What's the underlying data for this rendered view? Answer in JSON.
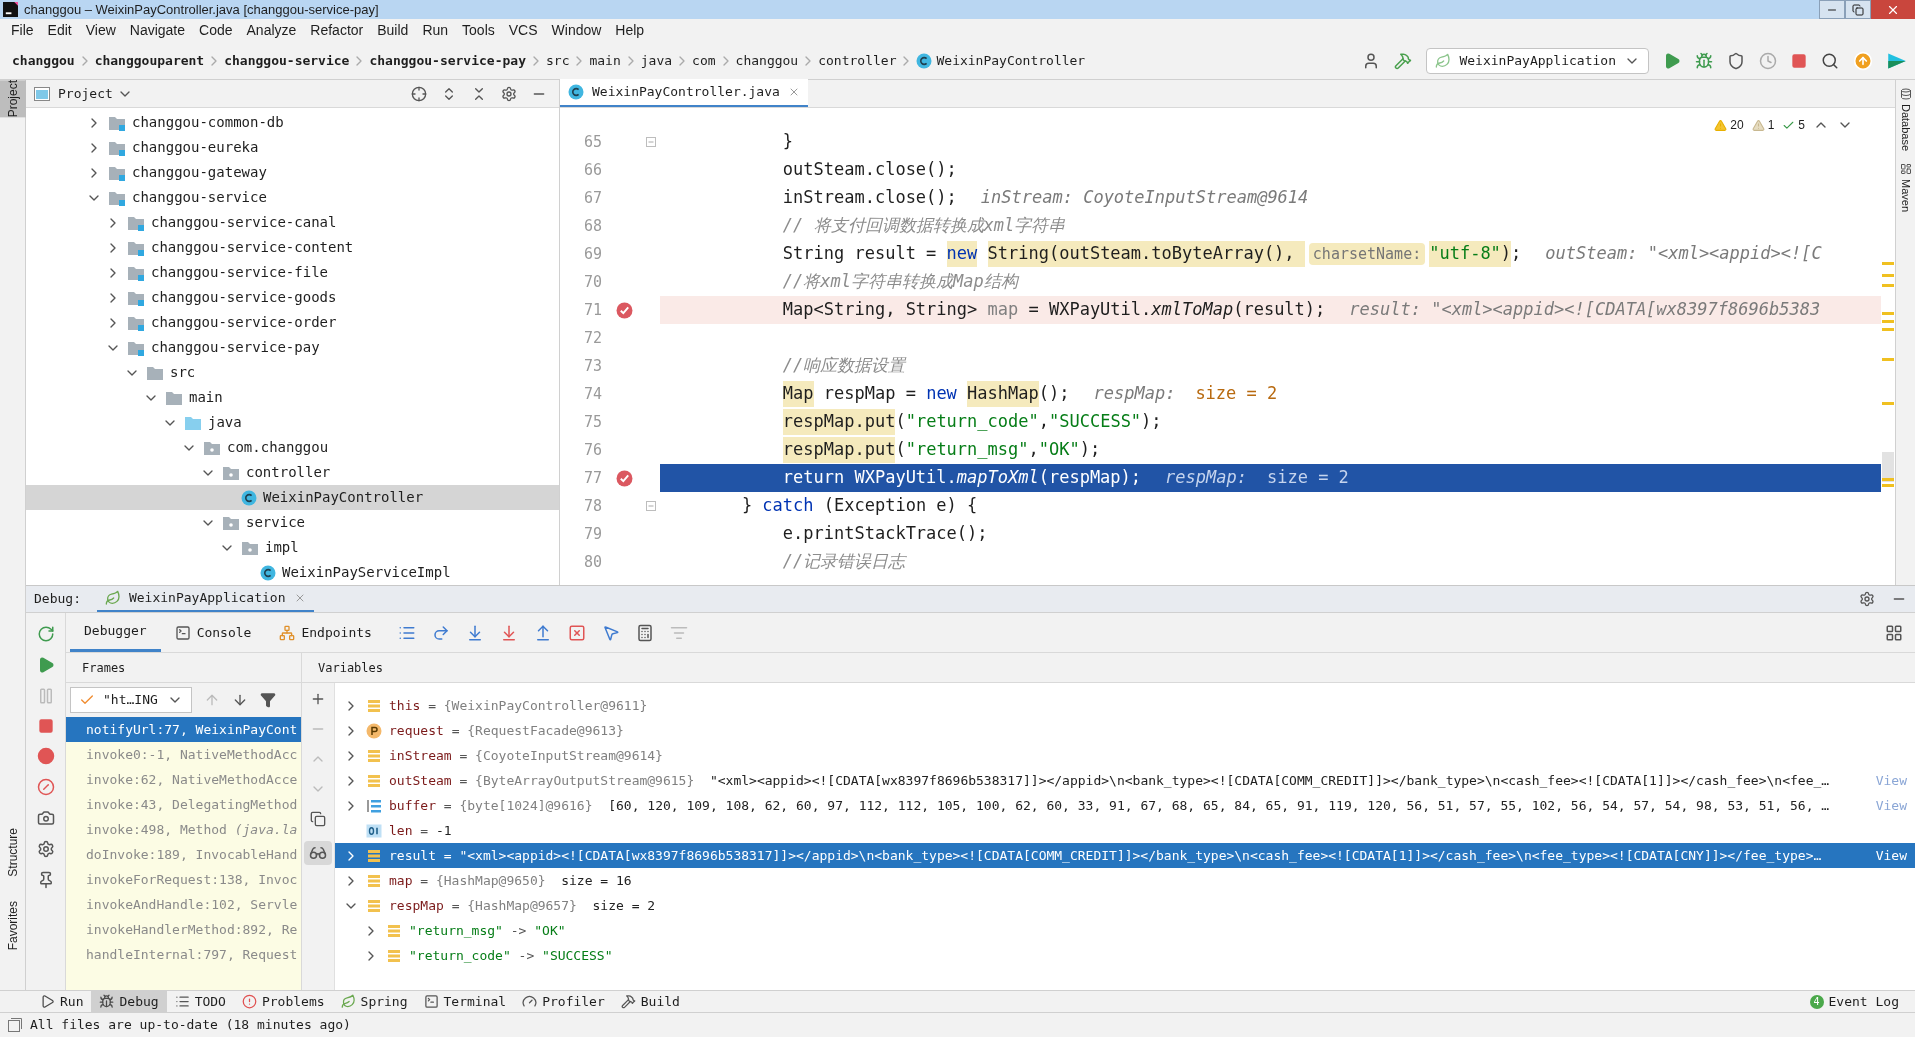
{
  "window": {
    "title": "changgou – WeixinPayController.java [changgou-service-pay]"
  },
  "menu": [
    {
      "label": "File"
    },
    {
      "label": "Edit"
    },
    {
      "label": "View"
    },
    {
      "label": "Navigate"
    },
    {
      "label": "Code"
    },
    {
      "label": "Analyze"
    },
    {
      "label": "Refactor"
    },
    {
      "label": "Build"
    },
    {
      "label": "Run"
    },
    {
      "label": "Tools"
    },
    {
      "label": "VCS"
    },
    {
      "label": "Window"
    },
    {
      "label": "Help"
    }
  ],
  "breadcrumb": [
    {
      "label": "changgou",
      "kind": "module"
    },
    {
      "label": "changgouparent",
      "kind": "module"
    },
    {
      "label": "changgou-service",
      "kind": "module"
    },
    {
      "label": "changgou-service-pay",
      "kind": "module"
    },
    {
      "label": "src",
      "kind": "folder"
    },
    {
      "label": "main",
      "kind": "folder"
    },
    {
      "label": "java",
      "kind": "folder"
    },
    {
      "label": "com",
      "kind": "folder"
    },
    {
      "label": "changgou",
      "kind": "folder"
    },
    {
      "label": "controller",
      "kind": "folder"
    },
    {
      "label": "WeixinPayController",
      "kind": "class"
    }
  ],
  "run_configuration": "WeixinPayApplication",
  "side_tabs_left": [
    {
      "label": "Project",
      "selected": true
    },
    {
      "label": "Structure",
      "selected": false
    },
    {
      "label": "Favorites",
      "selected": false
    }
  ],
  "side_tabs_right": [
    {
      "label": "Database"
    },
    {
      "label": "Maven"
    }
  ],
  "project_panel": {
    "title": "Project",
    "tree": [
      {
        "label": "changgou-common-db",
        "kind": "module",
        "expanded": false,
        "selected": false
      },
      {
        "label": "changgou-eureka",
        "kind": "module",
        "expanded": false,
        "selected": false
      },
      {
        "label": "changgou-gateway",
        "kind": "module",
        "expanded": false,
        "selected": false
      },
      {
        "label": "changgou-service",
        "kind": "module",
        "expanded": true,
        "selected": false,
        "children": [
          {
            "label": "changgou-service-canal",
            "kind": "module",
            "expanded": false,
            "selected": false
          },
          {
            "label": "changgou-service-content",
            "kind": "module",
            "expanded": false,
            "selected": false
          },
          {
            "label": "changgou-service-file",
            "kind": "module",
            "expanded": false,
            "selected": false
          },
          {
            "label": "changgou-service-goods",
            "kind": "module",
            "expanded": false,
            "selected": false
          },
          {
            "label": "changgou-service-order",
            "kind": "module",
            "expanded": false,
            "selected": false
          },
          {
            "label": "changgou-service-pay",
            "kind": "module",
            "expanded": true,
            "selected": false,
            "children": [
              {
                "label": "src",
                "kind": "folder",
                "expanded": true,
                "selected": false,
                "children": [
                  {
                    "label": "main",
                    "kind": "folder",
                    "expanded": true,
                    "selected": false,
                    "children": [
                      {
                        "label": "java",
                        "kind": "source-root",
                        "expanded": true,
                        "selected": false,
                        "children": [
                          {
                            "label": "com.changgou",
                            "kind": "package",
                            "expanded": true,
                            "selected": false,
                            "children": [
                              {
                                "label": "controller",
                                "kind": "package",
                                "expanded": true,
                                "selected": false,
                                "children": [
                                  {
                                    "label": "WeixinPayController",
                                    "kind": "class",
                                    "selected": true
                                  }
                                ]
                              },
                              {
                                "label": "service",
                                "kind": "package",
                                "expanded": true,
                                "selected": false,
                                "children": [
                                  {
                                    "label": "impl",
                                    "kind": "package",
                                    "expanded": true,
                                    "selected": false,
                                    "children": [
                                      {
                                        "label": "WeixinPayServiceImpl",
                                        "kind": "class",
                                        "selected": false
                                      }
                                    ]
                                  }
                                ]
                              }
                            ]
                          }
                        ]
                      }
                    ]
                  }
                ]
              }
            ]
          }
        ]
      }
    ]
  },
  "editor": {
    "tabs": [
      {
        "label": "WeixinPayController.java",
        "selected": true
      }
    ],
    "inspections": [
      {
        "kind": "warning",
        "count": "20"
      },
      {
        "kind": "weak-warning",
        "count": "1"
      },
      {
        "kind": "typo",
        "count": "5"
      }
    ],
    "lines": [
      {
        "number": "65",
        "breakpoint": false,
        "current": false,
        "fold": true,
        "segments": [
          {
            "text": "            }",
            "kind": "plain"
          }
        ]
      },
      {
        "number": "66",
        "breakpoint": false,
        "current": false,
        "fold": false,
        "segments": [
          {
            "text": "            outSteam.close();",
            "kind": "plain"
          }
        ]
      },
      {
        "number": "67",
        "breakpoint": false,
        "current": false,
        "fold": false,
        "segments": [
          {
            "text": "            inStream.close();",
            "kind": "plain"
          },
          {
            "text": "inStream: CoyoteInputStream@9614",
            "kind": "hint"
          }
        ]
      },
      {
        "number": "68",
        "breakpoint": false,
        "current": false,
        "fold": false,
        "segments": [
          {
            "text": "            // 将支付回调数据转换成xml字符串",
            "kind": "comment"
          }
        ]
      },
      {
        "number": "69",
        "breakpoint": false,
        "current": false,
        "fold": false,
        "segments": [
          {
            "text": "            String result = ",
            "kind": "plain"
          },
          {
            "text": "new",
            "kind": "keyword",
            "marked": true
          },
          {
            "text": " String(outSteam.toByteArray(), ",
            "kind": "plain",
            "marked": true
          },
          {
            "text": "charsetName:",
            "kind": "param-hint",
            "marked": true
          },
          {
            "text": "\"utf-8\"",
            "kind": "string",
            "marked": true
          },
          {
            "text": ")",
            "kind": "plain",
            "marked": true
          },
          {
            "text": ";",
            "kind": "plain"
          },
          {
            "text": "outSteam: \"<xml><appid><![C",
            "kind": "hint"
          }
        ]
      },
      {
        "number": "70",
        "breakpoint": false,
        "current": false,
        "fold": false,
        "segments": [
          {
            "text": "            //将xml字符串转换成Map结构",
            "kind": "comment"
          }
        ]
      },
      {
        "number": "71",
        "breakpoint": true,
        "current": false,
        "fold": false,
        "segments": [
          {
            "text": "            Map<String, String> ",
            "kind": "plain"
          },
          {
            "text": "map",
            "kind": "unused"
          },
          {
            "text": " = WXPayUtil.",
            "kind": "plain"
          },
          {
            "text": "xmlToMap",
            "kind": "method"
          },
          {
            "text": "(result);",
            "kind": "plain"
          },
          {
            "text": "result: \"<xml><appid><![CDATA[wx8397f8696b5383",
            "kind": "hint"
          }
        ]
      },
      {
        "number": "72",
        "breakpoint": false,
        "current": false,
        "fold": false
      },
      {
        "number": "73",
        "breakpoint": false,
        "current": false,
        "fold": false,
        "segments": [
          {
            "text": "            //响应数据设置",
            "kind": "comment"
          }
        ]
      },
      {
        "number": "74",
        "breakpoint": false,
        "current": false,
        "fold": false,
        "segments": [
          {
            "text": "            Map",
            "kind": "plain",
            "marked": true
          },
          {
            "text": " respMap = ",
            "kind": "plain"
          },
          {
            "text": "new",
            "kind": "keyword"
          },
          {
            "text": " HashMap",
            "kind": "plain",
            "marked": true
          },
          {
            "text": "();",
            "kind": "plain"
          },
          {
            "text": "respMap:",
            "kind": "hint"
          },
          {
            "text": "size = 2",
            "kind": "hint-value"
          }
        ]
      },
      {
        "number": "75",
        "breakpoint": false,
        "current": false,
        "fold": false,
        "segments": [
          {
            "text": "            respMap.put",
            "kind": "plain",
            "marked": true
          },
          {
            "text": "(",
            "kind": "plain"
          },
          {
            "text": "\"return_code\"",
            "kind": "string"
          },
          {
            "text": ",",
            "kind": "plain"
          },
          {
            "text": "\"SUCCESS\"",
            "kind": "string"
          },
          {
            "text": ");",
            "kind": "plain"
          }
        ]
      },
      {
        "number": "76",
        "breakpoint": false,
        "current": false,
        "fold": false,
        "segments": [
          {
            "text": "            respMap.put",
            "kind": "plain",
            "marked": true
          },
          {
            "text": "(",
            "kind": "plain"
          },
          {
            "text": "\"return_msg\"",
            "kind": "string"
          },
          {
            "text": ",",
            "kind": "plain"
          },
          {
            "text": "\"OK\"",
            "kind": "string"
          },
          {
            "text": ");",
            "kind": "plain"
          }
        ]
      },
      {
        "number": "77",
        "breakpoint": true,
        "current": true,
        "fold": false,
        "segments": [
          {
            "text": "            return WXPayUtil.",
            "kind": "plain"
          },
          {
            "text": "mapToXml",
            "kind": "method"
          },
          {
            "text": "(respMap);",
            "kind": "plain"
          },
          {
            "text": "respMap:",
            "kind": "hint"
          },
          {
            "text": "size = 2",
            "kind": "hint-value"
          }
        ]
      },
      {
        "number": "78",
        "breakpoint": false,
        "current": false,
        "fold": true,
        "segments": [
          {
            "text": "        } ",
            "kind": "plain"
          },
          {
            "text": "catch",
            "kind": "keyword"
          },
          {
            "text": " (Exception e) {",
            "kind": "plain"
          }
        ]
      },
      {
        "number": "79",
        "breakpoint": false,
        "current": false,
        "fold": false,
        "segments": [
          {
            "text": "            e.printStackTrace();",
            "kind": "plain"
          }
        ]
      },
      {
        "number": "80",
        "breakpoint": false,
        "current": false,
        "fold": false,
        "segments": [
          {
            "text": "            //记录错误日志",
            "kind": "comment"
          }
        ]
      }
    ]
  },
  "debug": {
    "label": "Debug:",
    "session": "WeixinPayApplication",
    "tabs": [
      {
        "label": "Debugger",
        "kind": "debugger",
        "selected": true
      },
      {
        "label": "Console",
        "kind": "console",
        "selected": false
      },
      {
        "label": "Endpoints",
        "kind": "endpoints",
        "selected": false
      }
    ],
    "frames_title": "Frames",
    "thread": "\"ht…ING",
    "frames": [
      {
        "text": "notifyUrl:77, WeixinPayCont",
        "selected": true
      },
      {
        "text": "invoke0:-1, NativeMethodAcc",
        "selected": false
      },
      {
        "text": "invoke:62, NativeMethodAcce",
        "selected": false
      },
      {
        "text": "invoke:43, DelegatingMethod",
        "selected": false
      },
      {
        "text": "invoke:498, Method *(java.la*",
        "selected": false
      },
      {
        "text": "doInvoke:189, InvocableHand",
        "selected": false
      },
      {
        "text": "invokeForRequest:138, Invoc",
        "selected": false
      },
      {
        "text": "invokeAndHandle:102, Servle",
        "selected": false
      },
      {
        "text": "invokeHandlerMethod:892, Re",
        "selected": false
      },
      {
        "text": "handleInternal:797, Request",
        "selected": false
      }
    ],
    "variables_title": "Variables",
    "variables": [
      {
        "name": "this",
        "separator": "=",
        "value": "{WeixinPayController@9611}",
        "kind": "field",
        "expanded": false,
        "selected": false
      },
      {
        "name": "request",
        "separator": "=",
        "value": "{RequestFacade@9613}",
        "kind": "parameter",
        "expanded": false,
        "selected": false
      },
      {
        "name": "inStream",
        "separator": "=",
        "value": "{CoyoteInputStream@9614}",
        "kind": "field",
        "expanded": false,
        "selected": false
      },
      {
        "name": "outSteam",
        "separator": "=",
        "value": "{ByteArrayOutputStream@9615}",
        "extra": "\"<xml><appid><![CDATA[wx8397f8696b538317]]></appid>\\n<bank_type><![CDATA[COMM_CREDIT]]></bank_type>\\n<cash_fee><![CDATA[1]]></cash_fee>\\n<fee_…",
        "link": "View",
        "kind": "field",
        "expanded": false,
        "selected": false
      },
      {
        "name": "buffer",
        "separator": "=",
        "value": "{byte[1024]@9616}",
        "extra": "[60, 120, 109, 108, 62, 60, 97, 112, 112, 105, 100, 62, 60, 33, 91, 67, 68, 65, 84, 65, 91, 119, 120, 56, 51, 57, 55, 102, 56, 54, 57, 54, 98, 53, 51, 56, …",
        "link": "View",
        "kind": "array",
        "expanded": false,
        "selected": false
      },
      {
        "name": "len",
        "separator": "=",
        "value": "-1",
        "kind": "primitive",
        "selected": false
      },
      {
        "name": "result",
        "separator": "=",
        "value": "\"<xml><appid><![CDATA[wx8397f8696b538317]]></appid>\\n<bank_type><![CDATA[COMM_CREDIT]]></bank_type>\\n<cash_fee><![CDATA[1]]></cash_fee>\\n<fee_type><![CDATA[CNY]]></fee_type>…",
        "link": "View",
        "kind": "field",
        "expanded": false,
        "selected": true
      },
      {
        "name": "map",
        "separator": "=",
        "value": "{HashMap@9650}",
        "extra": "size = 16",
        "kind": "field",
        "expanded": false,
        "selected": false
      },
      {
        "name": "respMap",
        "separator": "=",
        "value": "{HashMap@9657}",
        "extra": "size = 2",
        "kind": "field",
        "expanded": true,
        "selected": false,
        "children": [
          {
            "name": "\"return_msg\"",
            "separator": "->",
            "value": "\"OK\"",
            "kind": "entry",
            "expanded": false,
            "selected": false
          },
          {
            "name": "\"return_code\"",
            "separator": "->",
            "value": "\"SUCCESS\"",
            "kind": "entry",
            "expanded": false,
            "selected": false
          }
        ]
      }
    ]
  },
  "tool_windows": [
    {
      "label": "Run",
      "kind": "run",
      "selected": false
    },
    {
      "label": "Debug",
      "kind": "debug",
      "selected": true
    },
    {
      "label": "TODO",
      "kind": "todo",
      "selected": false
    },
    {
      "label": "Problems",
      "kind": "problems",
      "selected": false
    },
    {
      "label": "Spring",
      "kind": "spring",
      "selected": false
    },
    {
      "label": "Terminal",
      "kind": "terminal",
      "selected": false
    },
    {
      "label": "Profiler",
      "kind": "profiler",
      "selected": false
    },
    {
      "label": "Build",
      "kind": "build",
      "selected": false
    }
  ],
  "event_log": {
    "label": "Event Log",
    "count": "4"
  },
  "status_bar": {
    "message": "All files are up-to-date (18 minutes ago)"
  }
}
